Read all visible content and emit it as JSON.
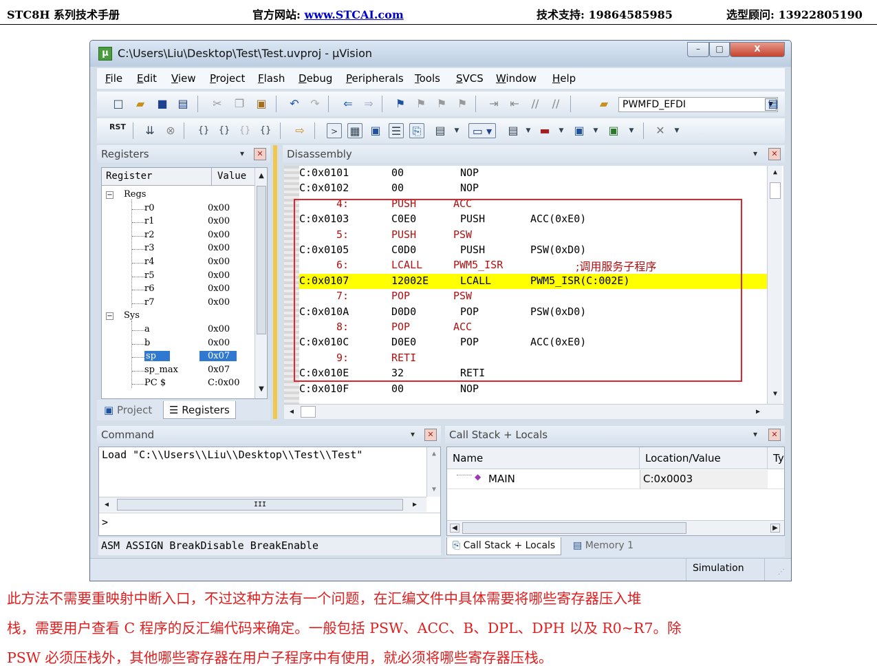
{
  "page_header": {
    "manual": "STC8H 系列技术手册",
    "site_label": "官方网站: ",
    "site_url": "www.STCAI.com",
    "support": "技术支持: 19864585985",
    "consult": "选型顾问: 13922805190"
  },
  "window": {
    "title": "C:\\Users\\Liu\\Desktop\\Test\\Test.uvproj - µVision",
    "controls": {
      "minimize": "–",
      "maximize": "□",
      "close": "X"
    }
  },
  "menu": [
    "File",
    "Edit",
    "View",
    "Project",
    "Flash",
    "Debug",
    "Peripherals",
    "Tools",
    "SVCS",
    "Window",
    "Help"
  ],
  "toolbar": {
    "target_select": "PWMFD_EFDI",
    "rst_label": "RST"
  },
  "registers_panel": {
    "title": "Registers",
    "col_register": "Register",
    "col_value": "Value",
    "groups": [
      {
        "name": "Regs",
        "items": [
          {
            "name": "r0",
            "value": "0x00"
          },
          {
            "name": "r1",
            "value": "0x00"
          },
          {
            "name": "r2",
            "value": "0x00"
          },
          {
            "name": "r3",
            "value": "0x00"
          },
          {
            "name": "r4",
            "value": "0x00"
          },
          {
            "name": "r5",
            "value": "0x00"
          },
          {
            "name": "r6",
            "value": "0x00"
          },
          {
            "name": "r7",
            "value": "0x00"
          }
        ]
      },
      {
        "name": "Sys",
        "items": [
          {
            "name": "a",
            "value": "0x00"
          },
          {
            "name": "b",
            "value": "0x00"
          },
          {
            "name": "sp",
            "value": "0x07"
          },
          {
            "name": "sp_max",
            "value": "0x07"
          },
          {
            "name": "PC  $",
            "value": "C:0x00"
          }
        ]
      }
    ],
    "tabs": [
      "Project",
      "Registers"
    ]
  },
  "disassembly": {
    "title": "Disassembly",
    "rows": [
      {
        "type": "asm",
        "c1": "C:0x0101",
        "c2": "00",
        "c3": "NOP",
        "c4": ""
      },
      {
        "type": "asm",
        "c1": "C:0x0102",
        "c2": "00",
        "c3": "NOP",
        "c4": ""
      },
      {
        "type": "src",
        "c1": "4:",
        "c2": "PUSH",
        "c3": "ACC",
        "c4": ""
      },
      {
        "type": "asm",
        "c1": "C:0x0103",
        "c2": "C0E0",
        "c3": "PUSH",
        "c4": "ACC(0xE0)"
      },
      {
        "type": "src",
        "c1": "5:",
        "c2": "PUSH",
        "c3": "PSW",
        "c4": ""
      },
      {
        "type": "asm",
        "c1": "C:0x0105",
        "c2": "C0D0",
        "c3": "PUSH",
        "c4": "PSW(0xD0)"
      },
      {
        "type": "src",
        "c1": "6:",
        "c2": "LCALL",
        "c3": "PWM5_ISR",
        "c4": ";调用服务子程序"
      },
      {
        "type": "hl",
        "c1": "C:0x0107",
        "c2": "12002E",
        "c3": "LCALL",
        "c4": "PWM5_ISR(C:002E)"
      },
      {
        "type": "src",
        "c1": "7:",
        "c2": "POP",
        "c3": "PSW",
        "c4": ""
      },
      {
        "type": "asm",
        "c1": "C:0x010A",
        "c2": "D0D0",
        "c3": "POP",
        "c4": "PSW(0xD0)"
      },
      {
        "type": "src",
        "c1": "8:",
        "c2": "POP",
        "c3": "ACC",
        "c4": ""
      },
      {
        "type": "asm",
        "c1": "C:0x010C",
        "c2": "D0E0",
        "c3": "POP",
        "c4": "ACC(0xE0)"
      },
      {
        "type": "src",
        "c1": "9:",
        "c2": "RETI",
        "c3": "",
        "c4": ""
      },
      {
        "type": "asm",
        "c1": "C:0x010E",
        "c2": "32",
        "c3": "RETI",
        "c4": ""
      },
      {
        "type": "asm",
        "c1": "C:0x010F",
        "c2": "00",
        "c3": "NOP",
        "c4": ""
      }
    ]
  },
  "command_panel": {
    "title": "Command",
    "output": "Load \"C:\\\\Users\\\\Liu\\\\Desktop\\\\Test\\\\Test\"",
    "prompt": ">",
    "hints": "ASM ASSIGN BreakDisable BreakEnable",
    "scroll_mark": "III"
  },
  "callstack_panel": {
    "title": "Call Stack + Locals",
    "col_name": "Name",
    "col_location": "Location/Value",
    "col_type": "Ty",
    "rows": [
      {
        "name": "MAIN",
        "location": "C:0x0003"
      }
    ],
    "tabs": [
      "Call Stack + Locals",
      "Memory 1"
    ]
  },
  "statusbar": {
    "mode": "Simulation"
  },
  "body_text": [
    "此方法不需要重映射中断入口，不过这种方法有一个问题，在汇编文件中具体需要将哪些寄存器压入堆",
    "栈，需要用户查看 C 程序的反汇编代码来确定。一般包括 PSW、ACC、B、DPL、DPH 以及 R0~R7。除",
    "PSW 必须压栈外，其他哪些寄存器在用户子程序中有使用，就必须将哪些寄存器压栈。"
  ],
  "colors": {
    "highlight": "#ffff00",
    "annotation_box": "#e0242a",
    "body_text": "#e02020",
    "link": "#0000cc"
  }
}
